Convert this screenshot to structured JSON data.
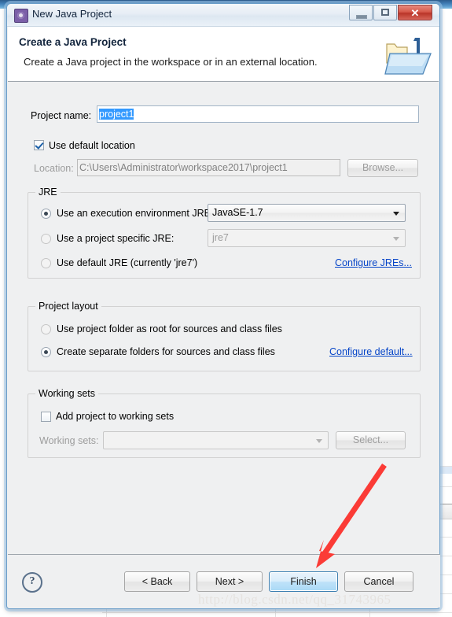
{
  "window": {
    "title": "New Java Project",
    "icon": "java-project-icon",
    "controls": {
      "minimize": "minimize-button",
      "maximize": "maximize-button",
      "close_glyph": "✕"
    }
  },
  "header": {
    "title": "Create a Java Project",
    "subtitle": "Create a Java project in the workspace or in an external location.",
    "icon": "java-folder-icon"
  },
  "form": {
    "project_name_label": "Project name:",
    "project_name_value": "project1",
    "use_default_location_label": "Use default location",
    "use_default_location_checked": true,
    "location_label": "Location:",
    "location_value": "C:\\Users\\Administrator\\workspace2017\\project1",
    "browse_label": "Browse..."
  },
  "jre": {
    "group_title": "JRE",
    "option_execution_env": "Use an execution environment JRE:",
    "execution_env_value": "JavaSE-1.7",
    "option_project_specific": "Use a project specific JRE:",
    "project_specific_value": "jre7",
    "option_default_jre": "Use default JRE (currently 'jre7')",
    "configure_link": "Configure JREs...",
    "selected": "execution_env"
  },
  "project_layout": {
    "group_title": "Project layout",
    "option_root_folder": "Use project folder as root for sources and class files",
    "option_separate_folders": "Create separate folders for sources and class files",
    "configure_link": "Configure default...",
    "selected": "separate_folders"
  },
  "working_sets": {
    "group_title": "Working sets",
    "add_to_working_sets_label": "Add project to working sets",
    "add_to_working_sets_checked": false,
    "working_sets_label": "Working sets:",
    "working_sets_value": "",
    "select_label": "Select..."
  },
  "footer": {
    "help_glyph": "?",
    "back_label": "< Back",
    "next_label": "Next >",
    "finish_label": "Finish",
    "cancel_label": "Cancel",
    "default_button": "finish"
  },
  "annotation": {
    "arrow_color": "#fb3b36",
    "points_to": "finish-button"
  },
  "watermark": {
    "text": "http://blog.csdn.net/qq_31743965"
  },
  "colors": {
    "selection_blue": "#3399ff",
    "link_blue": "#0645c8",
    "dialog_bg": "#eff0f1",
    "close_red": "#b93528"
  }
}
